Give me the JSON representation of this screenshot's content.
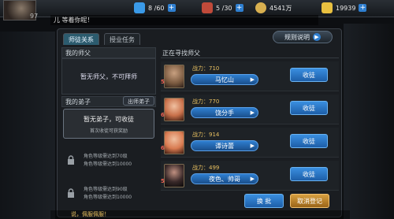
{
  "topbar": {
    "level_label": "97",
    "level_value": "9 7",
    "resources": [
      {
        "name": "stamina",
        "value": "8 /60",
        "icon": "lightning-icon",
        "color": "#3a9ae8"
      },
      {
        "name": "energy",
        "value": "5 /30",
        "icon": "flask-icon",
        "color": "#c04a3a"
      },
      {
        "name": "copper",
        "value": "4541万",
        "icon": "coin-icon",
        "color": "#d8b050"
      },
      {
        "name": "gold",
        "value": "19939",
        "icon": "ingot-icon",
        "color": "#e8c040"
      }
    ],
    "marquee": "儿 等着你呢！"
  },
  "tabs": [
    {
      "label": "师徒关系",
      "active": true
    },
    {
      "label": "授业任务",
      "active": false
    }
  ],
  "rules_button": "规则说明",
  "left": {
    "master_header": "我的师父",
    "master_status": "暂无师父，不可拜师",
    "students_header": "我的弟子",
    "dismiss_button": "出师弟子",
    "recruit_title": "暂无弟子，可收徒",
    "recruit_sub": "首次收徒可获奖励",
    "locked_slots": [
      {
        "line1": "角色等级需达到70级",
        "line2": "角色等级需达到10000"
      },
      {
        "line1": "角色等级需达到90级",
        "line2": "角色等级需达到10000"
      }
    ]
  },
  "right": {
    "header": "正在寻找师父",
    "power_label": "战力：",
    "recruit_label": "收徒",
    "candidates": [
      {
        "name": "马忆山",
        "power": "710",
        "rank": "5",
        "portrait_color": "#7a5a40"
      },
      {
        "name": "饶分手",
        "power": "770",
        "rank": "6",
        "portrait_color": "#c8704a"
      },
      {
        "name": "谭诗蕾",
        "power": "914",
        "rank": "6",
        "portrait_color": "#d87a50"
      },
      {
        "name": "夜色、帅哥",
        "power": "499",
        "rank": "5",
        "portrait_color": "#3a2a2a"
      }
    ]
  },
  "footer": {
    "swap_button": "换 批",
    "cancel_button": "取消登记",
    "strip_text": "说，佩服佩服！"
  }
}
